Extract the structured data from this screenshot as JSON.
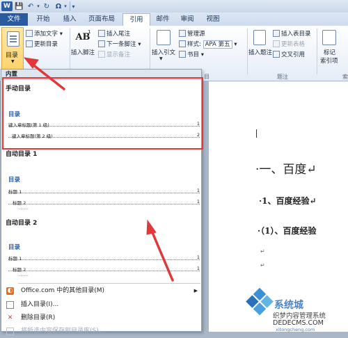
{
  "titlebar": {
    "app_logo": "W",
    "qat_icons": [
      "save-icon",
      "undo-icon",
      "redo-icon",
      "symbol-icon"
    ],
    "symbol_glyph": "Ω",
    "more": "▾"
  },
  "tabs": [
    "文件",
    "开始",
    "插入",
    "页面布局",
    "引用",
    "邮件",
    "审阅",
    "视图"
  ],
  "ribbon": {
    "toc_label": "目录",
    "add_text": "添加文字",
    "update_table": "更新目录",
    "insert_footnote": "插入脚注",
    "insert_endnote": "插入尾注",
    "next_footnote": "下一条脚注",
    "show_notes": "显示备注",
    "insert_citation": "插入引文",
    "manage_sources": "管理源",
    "style_label": "样式:",
    "style_value": "APA 第五",
    "bibliography": "书目",
    "group_citations": "目",
    "insert_caption": "插入题注",
    "insert_table_of_figures": "插入表目录",
    "update_table_fig": "更新表格",
    "cross_reference": "交叉引用",
    "group_captions": "题注",
    "mark_entry": "标记",
    "mark_entry_2": "索引项",
    "group_index": "索"
  },
  "dropdown": {
    "header": "内置",
    "manual": {
      "title": "手动目录",
      "toc": "目录",
      "lines": [
        {
          "text": "键入章标题(第 1 级)",
          "page": "1"
        },
        {
          "text": "键入章标题(第 2 级)",
          "page": "2"
        }
      ]
    },
    "auto1": {
      "title": "自动目录 1",
      "toc": "目录",
      "lines": [
        {
          "text": "标题 1",
          "page": "1"
        },
        {
          "text": "标题 2",
          "page": "1"
        }
      ]
    },
    "auto2": {
      "title": "自动目录 2",
      "toc": "目录",
      "lines": [
        {
          "text": "标题 1",
          "page": "1"
        },
        {
          "text": "标题 2",
          "page": "1"
        }
      ]
    },
    "menu": {
      "office_more": "Office.com 中的其他目录(M)",
      "insert_toc": "插入目录(I)...",
      "remove_toc": "删除目录(R)",
      "save_selection": "将所选内容保存到目录库(S)..."
    }
  },
  "document": {
    "heading1": "·一、百度↵",
    "heading2": "·1、百度经验↵",
    "heading3": "·（1）、百度经验",
    "para_mark": "↵"
  },
  "watermark": {
    "title": "系统城",
    "subtitle": "织梦内容管理系统",
    "url": "DEDECMS.COM",
    "pinyin": "xitongcheng.com"
  },
  "colors": {
    "file_tab": "#2a5aa0",
    "highlight": "#e0383b",
    "arrow": "#e0383b",
    "toc_button": "#ffd36a"
  }
}
